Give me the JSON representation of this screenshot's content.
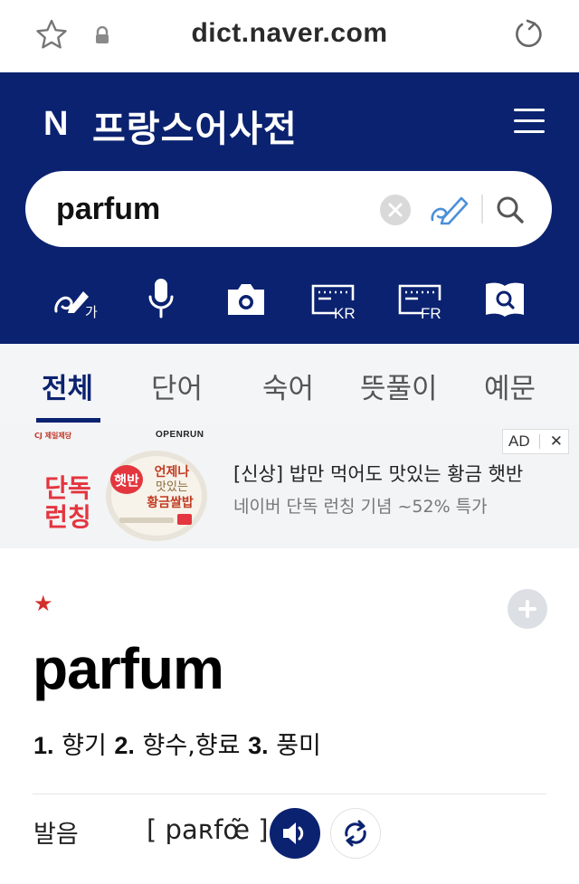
{
  "browser": {
    "url": "dict.naver.com"
  },
  "header": {
    "logo": "N",
    "title": "프랑스어사전"
  },
  "search": {
    "query": "parfum"
  },
  "tools": {
    "handwriting_ko_label": "가",
    "keyboard_kr_label": "KR",
    "keyboard_fr_label": "FR"
  },
  "tabs": [
    {
      "label": "전체",
      "active": true
    },
    {
      "label": "단어",
      "active": false
    },
    {
      "label": "숙어",
      "active": false
    },
    {
      "label": "뜻풀이",
      "active": false
    },
    {
      "label": "예문",
      "active": false
    }
  ],
  "ad": {
    "badge": "AD",
    "close": "✕",
    "brand_small": "CJ 제일제당",
    "brand": "OPENRUN",
    "promo_line1": "단독",
    "promo_line2": "런칭",
    "product_label": "햇반",
    "product_name_line1": "언제나",
    "product_name_line2": "맛있는",
    "product_name_line3": "황금쌀밥",
    "title": "[신상] 밥만 먹어도 맛있는 황금 햇반",
    "description": "네이버 단독 런칭 기념 ~52% 특가"
  },
  "entry": {
    "headword": "parfum",
    "meanings": [
      {
        "num": "1.",
        "text": "향기"
      },
      {
        "num": "2.",
        "text": "향수,향료"
      },
      {
        "num": "3.",
        "text": "풍미"
      }
    ],
    "pronunciation_label": "발음",
    "pronunciation": "[ paʀfœ̃ ]"
  },
  "colors": {
    "header_bg": "#0b2270",
    "accent": "#0b2270",
    "star": "#d3302c",
    "promo_red": "#e4353f"
  }
}
